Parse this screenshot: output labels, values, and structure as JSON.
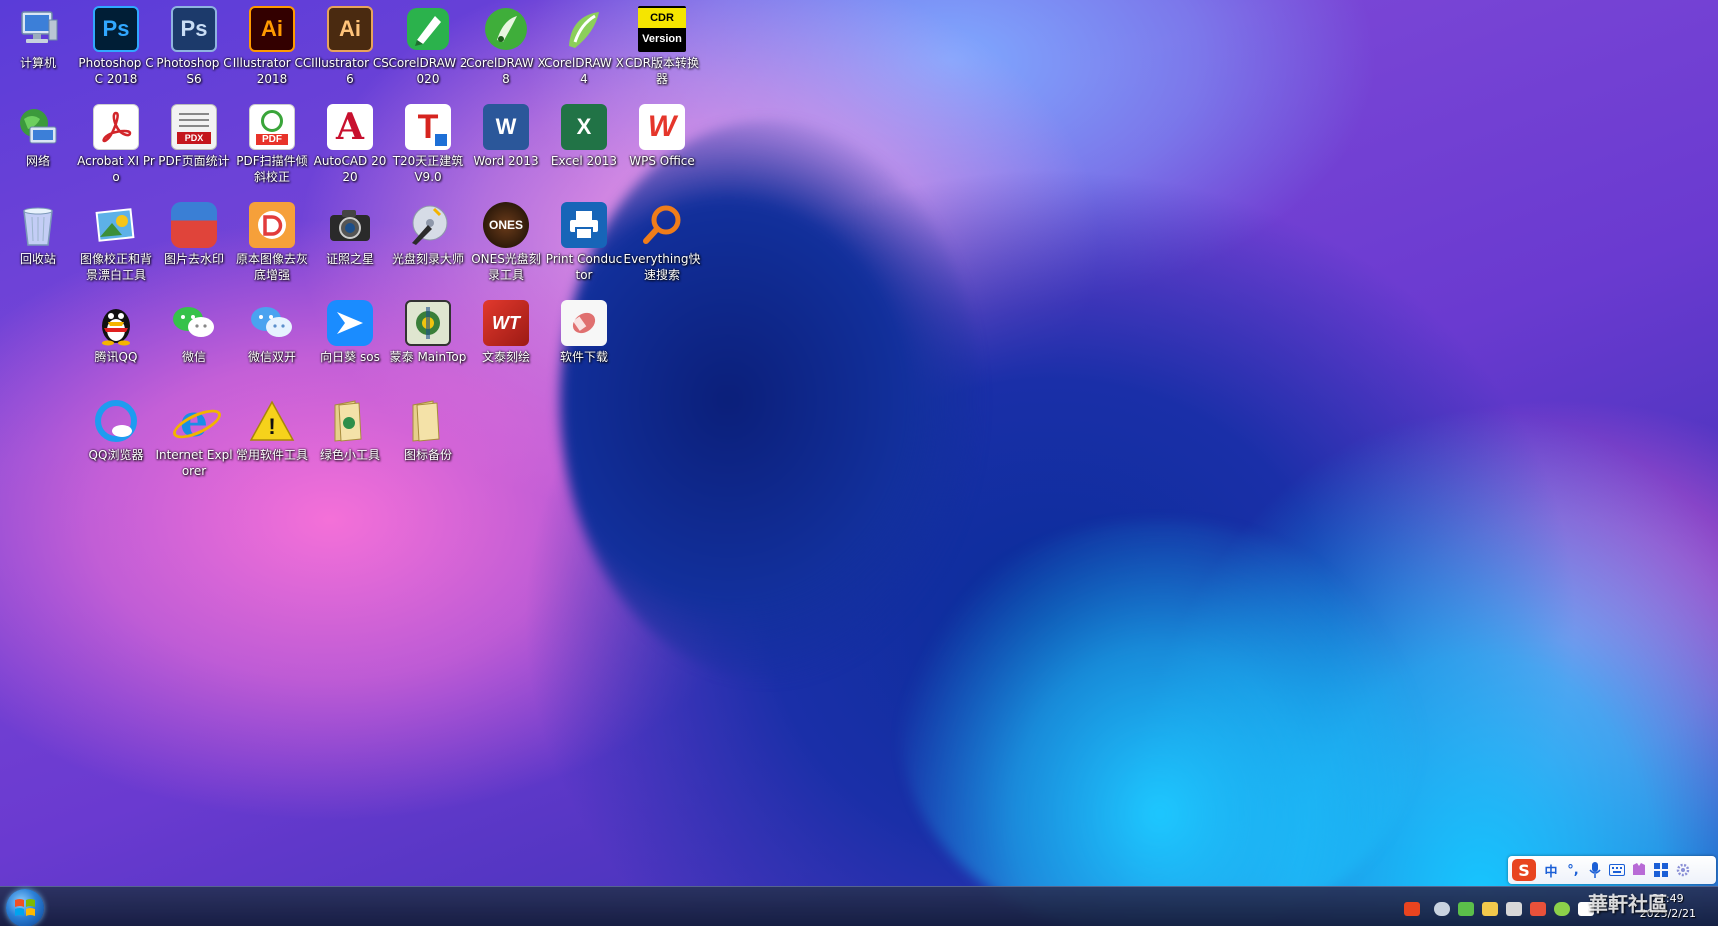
{
  "desktop": {
    "icons": [
      {
        "label": "计算机"
      },
      {
        "label": "Photoshop CC 2018",
        "text": "Ps"
      },
      {
        "label": "Photoshop CS6",
        "text": "Ps"
      },
      {
        "label": "Illustrator CC 2018",
        "text": "Ai"
      },
      {
        "label": "Illustrator CS6",
        "text": "Ai"
      },
      {
        "label": "CorelDRAW 2020"
      },
      {
        "label": "CorelDRAW X8"
      },
      {
        "label": "CorelDRAW X4"
      },
      {
        "label": "CDR版本转换器",
        "text_top": "CDR",
        "text_bottom": "Version"
      },
      {
        "label": "网络"
      },
      {
        "label": "Acrobat XI Pro"
      },
      {
        "label": "PDF页面统计",
        "text": "PDX"
      },
      {
        "label": "PDF扫描件倾斜校正",
        "text": "PDF"
      },
      {
        "label": "AutoCAD 2020",
        "text": "A"
      },
      {
        "label": "T20天正建筑 V9.0",
        "text": "T"
      },
      {
        "label": "Word 2013",
        "text": "W"
      },
      {
        "label": "Excel 2013",
        "text": "X"
      },
      {
        "label": "WPS Office",
        "text": "W"
      },
      {
        "label": "回收站"
      },
      {
        "label": "图像校正和背景漂白工具"
      },
      {
        "label": "图片去水印"
      },
      {
        "label": "原本图像去灰底增强"
      },
      {
        "label": "证照之星"
      },
      {
        "label": "光盘刻录大师"
      },
      {
        "label": "ONES光盘刻录工具",
        "text": "ONES"
      },
      {
        "label": "Print Conductor"
      },
      {
        "label": "Everything快速搜索"
      },
      {
        "label": "腾讯QQ"
      },
      {
        "label": "微信"
      },
      {
        "label": "微信双开"
      },
      {
        "label": "向日葵 sos"
      },
      {
        "label": "蒙泰 MainTop"
      },
      {
        "label": "文泰刻绘",
        "text": "WT"
      },
      {
        "label": "软件下载"
      },
      {
        "label": "QQ浏览器"
      },
      {
        "label": "Internet Explorer",
        "text": "e"
      },
      {
        "label": "常用软件工具",
        "text": "!"
      },
      {
        "label": "绿色小工具"
      },
      {
        "label": "图标备份"
      }
    ]
  },
  "taskbar": {
    "clock_time": "21:49",
    "clock_date": "2025/2/21",
    "ime_mode": "中",
    "watermark": "華軒社區"
  },
  "colors": {
    "ps_bg": "#001e36",
    "ps_fg": "#31a8ff",
    "ai_bg": "#330000",
    "ai_fg": "#ff9a00",
    "cdr_bg": "#f5e500"
  }
}
